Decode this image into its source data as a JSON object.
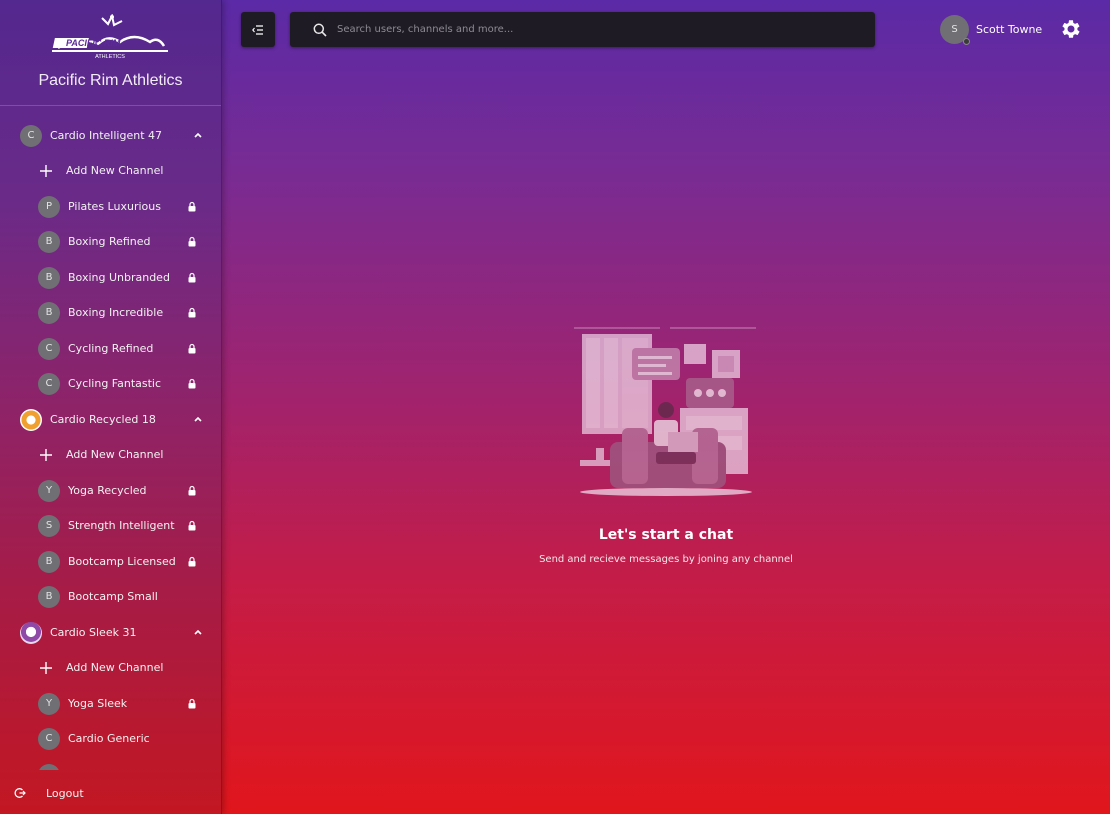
{
  "brand": {
    "name": "Pacific Rim Athletics",
    "logo_text": "PACIFIC RIM",
    "logo_subtext": "ATHLETICS"
  },
  "search": {
    "placeholder": "Search users, channels and more..."
  },
  "user": {
    "initial": "S",
    "name": "Scott Towne"
  },
  "sidebar": {
    "groups": [
      {
        "avatar": "C",
        "name": "Cardio Intelligent 47",
        "add_label": "Add New Channel",
        "channels": [
          {
            "initial": "P",
            "name": "Pilates Luxurious",
            "locked": true
          },
          {
            "initial": "B",
            "name": "Boxing Refined",
            "locked": true
          },
          {
            "initial": "B",
            "name": "Boxing Unbranded",
            "locked": true
          },
          {
            "initial": "B",
            "name": "Boxing Incredible",
            "locked": true
          },
          {
            "initial": "C",
            "name": "Cycling Refined",
            "locked": true
          },
          {
            "initial": "C",
            "name": "Cycling Fantastic",
            "locked": true
          }
        ]
      },
      {
        "avatar": "",
        "name": "Cardio Recycled 18",
        "add_label": "Add New Channel",
        "channels": [
          {
            "initial": "Y",
            "name": "Yoga Recycled",
            "locked": true
          },
          {
            "initial": "S",
            "name": "Strength Intelligent",
            "locked": true
          },
          {
            "initial": "B",
            "name": "Bootcamp Licensed",
            "locked": true
          },
          {
            "initial": "B",
            "name": "Bootcamp Small",
            "locked": false
          }
        ]
      },
      {
        "avatar": "",
        "name": "Cardio Sleek 31",
        "add_label": "Add New Channel",
        "channels": [
          {
            "initial": "Y",
            "name": "Yoga Sleek",
            "locked": true
          },
          {
            "initial": "C",
            "name": "Cardio Generic",
            "locked": false
          }
        ]
      }
    ],
    "logout_label": "Logout"
  },
  "empty_state": {
    "title": "Let's start a chat",
    "subtitle": "Send and recieve messages by joning any channel"
  },
  "colors": {
    "panel": "#1f1b24",
    "avatar": "#6f6f74"
  }
}
